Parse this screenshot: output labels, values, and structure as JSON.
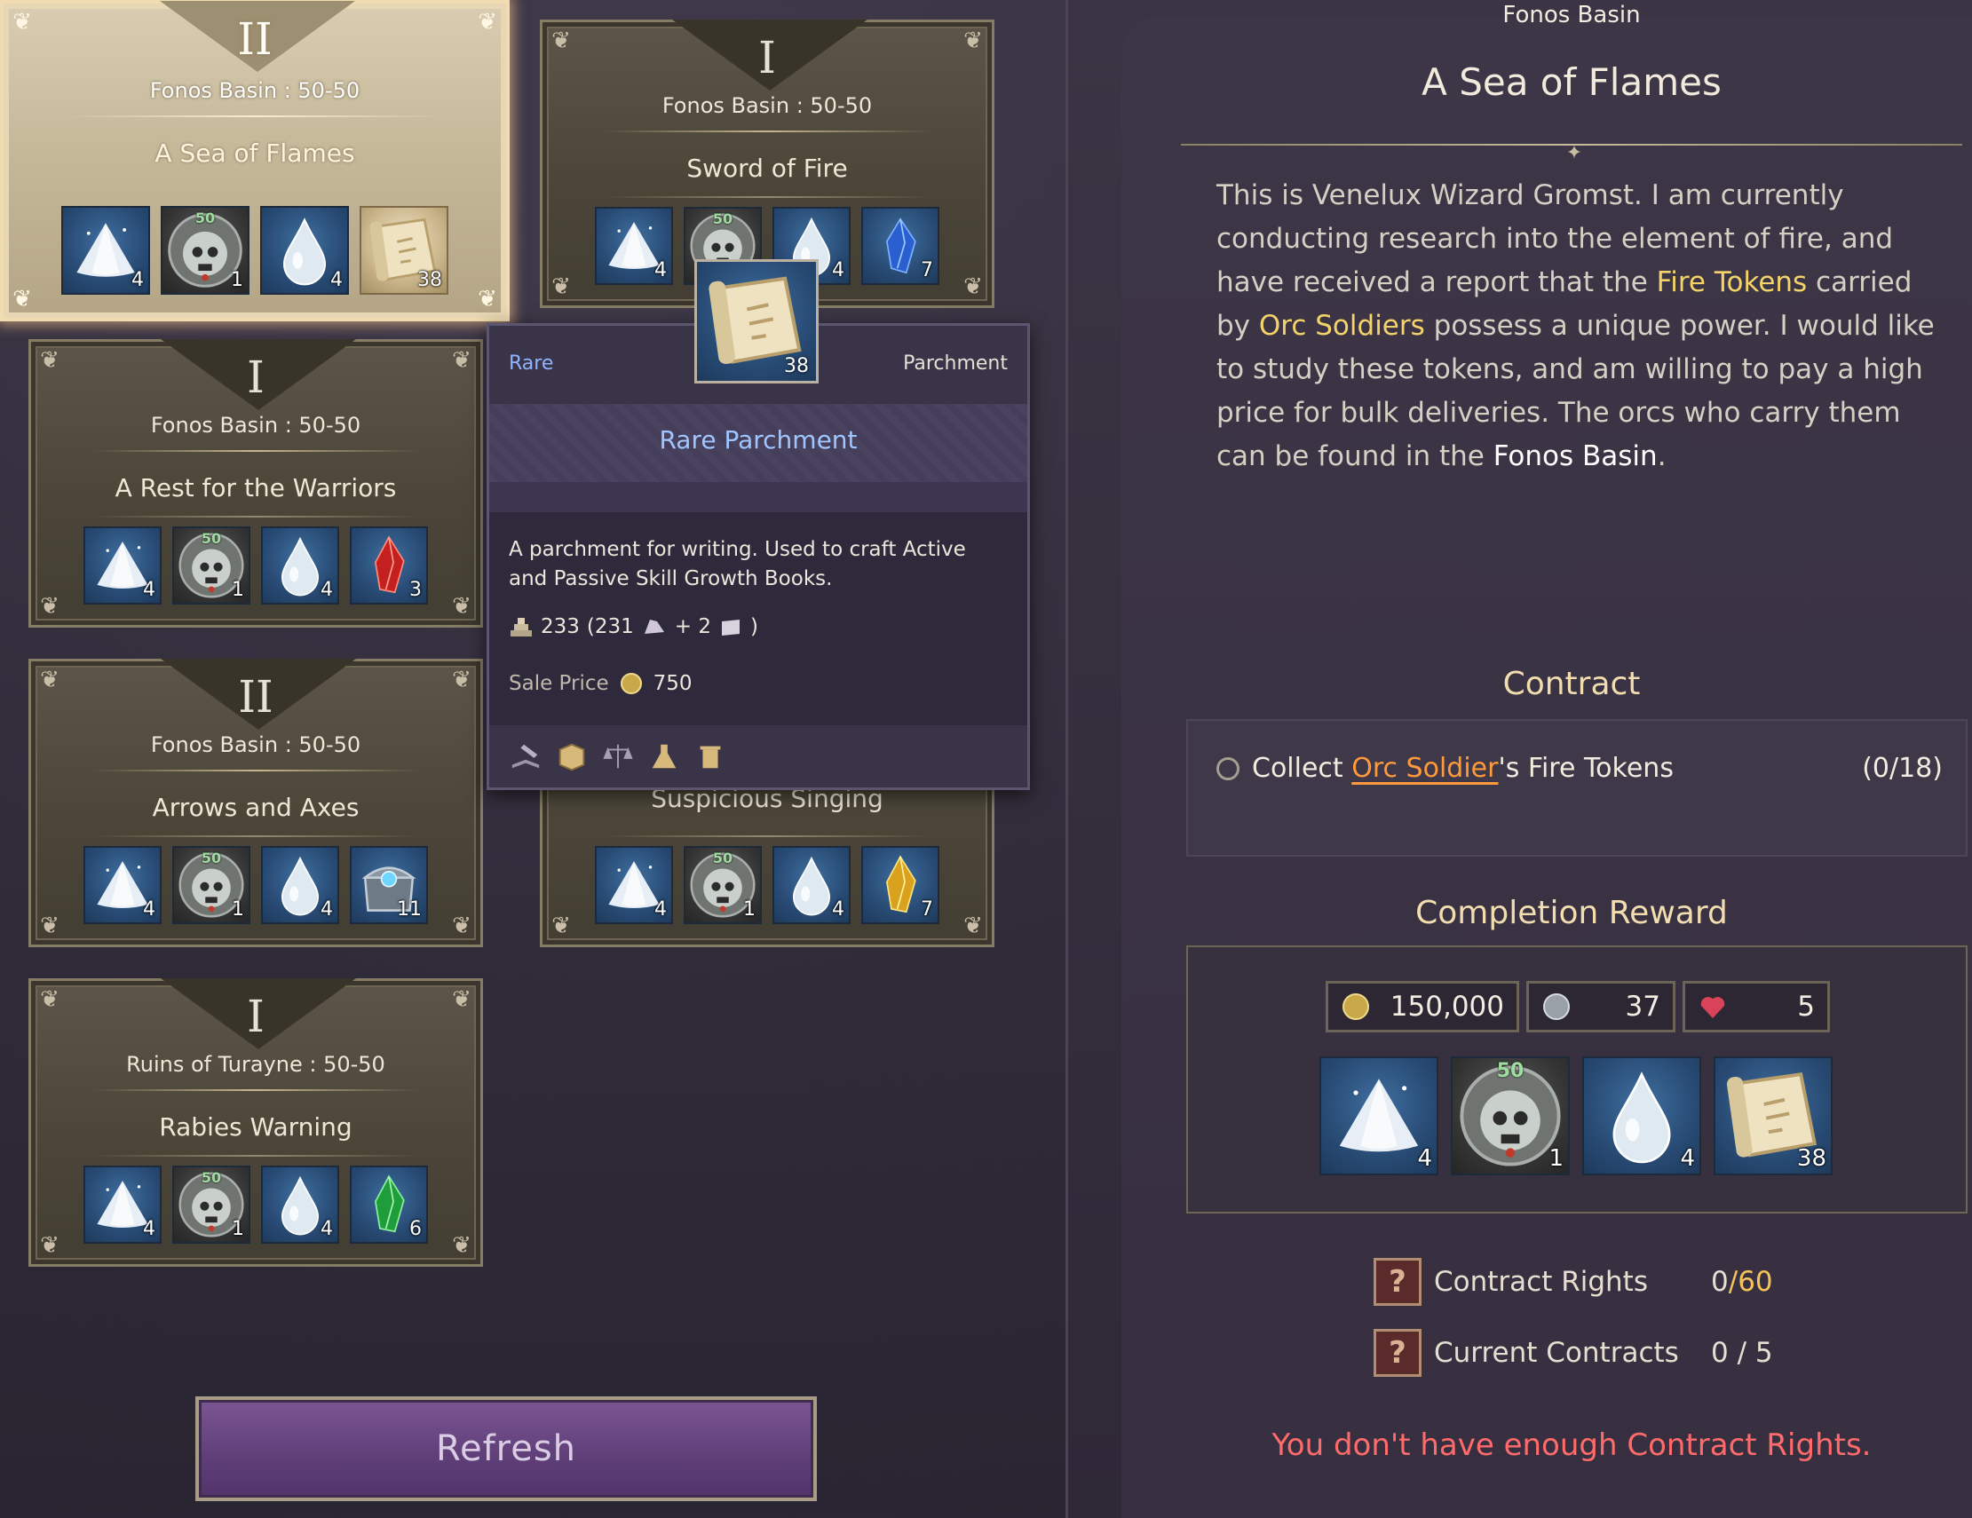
{
  "colors": {
    "accent_yellow": "#f4d46a",
    "accent_orange": "#ff9a3c",
    "warning_red": "#ff6b6b",
    "rarity_rare": "#8fb4ff",
    "refresh_purple": "#5f3e78"
  },
  "contracts": [
    {
      "tier": "II",
      "region": "Fonos Basin",
      "level": "50-50",
      "title": "A Sea of Flames",
      "selected": true,
      "rewards": [
        {
          "icon": "silver-powder-icon",
          "count": "4"
        },
        {
          "icon": "skull-medallion-icon",
          "level": "50",
          "count": "1"
        },
        {
          "icon": "water-drop-icon",
          "count": "4"
        },
        {
          "icon": "parchment-icon",
          "count": "38"
        }
      ]
    },
    {
      "tier": "I",
      "region": "Fonos Basin",
      "level": "50-50",
      "title": "Sword of Fire",
      "rewards": [
        {
          "icon": "silver-powder-icon",
          "count": "4"
        },
        {
          "icon": "skull-medallion-icon",
          "level": "50",
          "count": "1"
        },
        {
          "icon": "water-drop-icon",
          "count": "4"
        },
        {
          "icon": "blue-crystal-icon",
          "count": "7"
        }
      ]
    },
    {
      "tier": "I",
      "region": "Fonos Basin",
      "level": "50-50",
      "title": "A Rest for the Warriors",
      "rewards": [
        {
          "icon": "silver-powder-icon",
          "count": "4"
        },
        {
          "icon": "skull-medallion-icon",
          "level": "50",
          "count": "1"
        },
        {
          "icon": "water-drop-icon",
          "count": "4"
        },
        {
          "icon": "red-crystal-icon",
          "count": "3"
        }
      ]
    },
    {
      "tier": "II",
      "region": "Fonos Basin",
      "level": "50-50",
      "title": "Arrows and Axes",
      "rewards": [
        {
          "icon": "silver-powder-icon",
          "count": "4"
        },
        {
          "icon": "skull-medallion-icon",
          "level": "50",
          "count": "1"
        },
        {
          "icon": "water-drop-icon",
          "count": "4"
        },
        {
          "icon": "treasure-chest-icon",
          "count": "11"
        }
      ]
    },
    {
      "tier": "",
      "region": "",
      "level": "",
      "title": "Suspicious Singing",
      "rewards": [
        {
          "icon": "silver-powder-icon",
          "count": "4"
        },
        {
          "icon": "skull-medallion-icon",
          "level": "50",
          "count": "1"
        },
        {
          "icon": "water-drop-icon",
          "count": "4"
        },
        {
          "icon": "yellow-crystal-icon",
          "count": "7"
        }
      ]
    },
    {
      "tier": "I",
      "region": "Ruins of Turayne",
      "level": "50-50",
      "title": "Rabies Warning",
      "rewards": [
        {
          "icon": "silver-powder-icon",
          "count": "4"
        },
        {
          "icon": "skull-medallion-icon",
          "level": "50",
          "count": "1"
        },
        {
          "icon": "water-drop-icon",
          "count": "4"
        },
        {
          "icon": "green-crystal-icon",
          "count": "6"
        }
      ]
    }
  ],
  "tooltip": {
    "icon_count": "38",
    "rarity": "Rare",
    "type": "Parchment",
    "name": "Rare Parchment",
    "description": "A parchment for writing. Used to craft Active and Passive Skill Growth Books.",
    "stock_total": "233",
    "stock_detail_open": "(231",
    "stock_plus": "+ 2",
    "stock_close": ")",
    "sale_price_label": "Sale Price",
    "sale_price_value": "750"
  },
  "refresh_label": "Refresh",
  "detail": {
    "region": "Fonos Basin",
    "title": "A Sea of Flames",
    "desc_1": "This is Venelux Wizard Gromst. I am currently conducting research into the element of fire, and have received a report that the ",
    "desc_hl_1": "Fire Tokens",
    "desc_2": " carried by ",
    "desc_hl_2": "Orc Soldiers",
    "desc_3": " possess a unique power. I would like to study these tokens, and am willing to pay a high price for bulk deliveries. The orcs who carry them can be found in the ",
    "desc_hl_3": "Fonos Basin",
    "desc_4": ".",
    "contract_title": "Contract",
    "objective_prefix": "Collect ",
    "objective_link": "Orc Soldier",
    "objective_suffix": "'s Fire Tokens",
    "objective_progress": "(0/18)",
    "completion_title": "Completion Reward",
    "currencies": [
      {
        "icon": "gold-coin-icon",
        "value": "150,000"
      },
      {
        "icon": "silver-coin-icon",
        "value": "37"
      },
      {
        "icon": "heart-icon",
        "value": "5"
      }
    ],
    "reward_items": [
      {
        "icon": "silver-powder-icon",
        "count": "4"
      },
      {
        "icon": "skull-medallion-icon",
        "level": "50",
        "count": "1"
      },
      {
        "icon": "water-drop-icon",
        "count": "4"
      },
      {
        "icon": "parchment-icon",
        "count": "38"
      }
    ],
    "contract_rights_label": "Contract Rights",
    "contract_rights_value": "0",
    "contract_rights_sep": "/",
    "contract_rights_max": "60",
    "current_contracts_label": "Current Contracts",
    "current_contracts_value": "0 / 5",
    "warning": "You don't have enough Contract Rights."
  }
}
